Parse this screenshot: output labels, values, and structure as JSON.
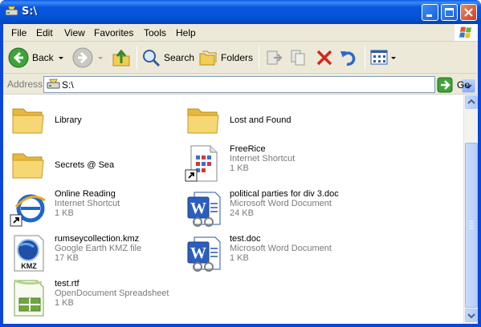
{
  "window": {
    "title": "S:\\"
  },
  "menu": [
    "File",
    "Edit",
    "View",
    "Favorites",
    "Tools",
    "Help"
  ],
  "toolbar": {
    "back": "Back",
    "search": "Search",
    "folders": "Folders"
  },
  "address": {
    "label": "Address",
    "value": "S:\\",
    "go": "Go"
  },
  "items": [
    {
      "name": "Library",
      "type": "",
      "size": "",
      "icon": "folder-icon"
    },
    {
      "name": "Lost and Found",
      "type": "",
      "size": "",
      "icon": "folder-icon"
    },
    {
      "name": "Secrets @ Sea",
      "type": "",
      "size": "",
      "icon": "folder-icon"
    },
    {
      "name": "FreeRice",
      "type": "Internet Shortcut",
      "size": "1 KB",
      "icon": "internet-shortcut-icon"
    },
    {
      "name": "Online Reading",
      "type": "Internet Shortcut",
      "size": "1 KB",
      "icon": "ie-shortcut-icon"
    },
    {
      "name": "political parties for div 3.doc",
      "type": "Microsoft Word Document",
      "size": "24 KB",
      "icon": "word-document-icon"
    },
    {
      "name": "rumseycollection.kmz",
      "type": "Google Earth KMZ file",
      "size": "17 KB",
      "icon": "kmz-file-icon"
    },
    {
      "name": "test.doc",
      "type": "Microsoft Word Document",
      "size": "1 KB",
      "icon": "word-document-icon"
    },
    {
      "name": "test.rtf",
      "type": "OpenDocument Spreadsheet",
      "size": "1 KB",
      "icon": "spreadsheet-icon"
    }
  ],
  "colors": {
    "titlebar": "#0454d8",
    "chrome": "#ece9d8",
    "secondary_text": "#7a7a7a",
    "folder": "#f2cd55"
  }
}
